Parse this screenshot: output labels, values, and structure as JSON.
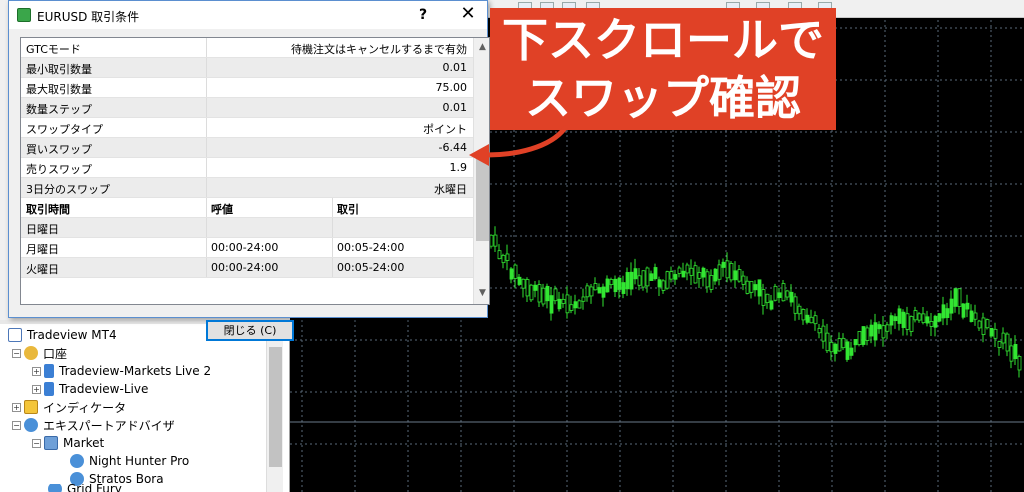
{
  "dialog": {
    "title": "EURUSD 取引条件",
    "help": "?",
    "close": "✕",
    "close_button": "閉じる (C)"
  },
  "specs": [
    {
      "label": "GTCモード",
      "value": "待機注文はキャンセルするまで有効"
    },
    {
      "label": "最小取引数量",
      "value": "0.01"
    },
    {
      "label": "最大取引数量",
      "value": "75.00"
    },
    {
      "label": "数量ステップ",
      "value": "0.01"
    },
    {
      "label": "スワップタイプ",
      "value": "ポイント"
    },
    {
      "label": "買いスワップ",
      "value": "-6.44"
    },
    {
      "label": "売りスワップ",
      "value": "1.9"
    },
    {
      "label": "3日分のスワップ",
      "value": "水曜日"
    }
  ],
  "sessions": {
    "headers": [
      "取引時間",
      "呼値",
      "取引"
    ],
    "rows": [
      [
        "日曜日",
        "",
        ""
      ],
      [
        "月曜日",
        "00:00-24:00",
        "00:05-24:00"
      ],
      [
        "火曜日",
        "00:00-24:00",
        "00:05-24:00"
      ]
    ]
  },
  "navigator": {
    "root": "Tradeview MT4",
    "items": [
      {
        "label": "口座"
      },
      {
        "label": "Tradeview-Markets Live 2"
      },
      {
        "label": "Tradeview-Live"
      },
      {
        "label": "インディケータ"
      },
      {
        "label": "エキスパートアドバイザ"
      },
      {
        "label": "Market"
      },
      {
        "label": "Night Hunter Pro"
      },
      {
        "label": "Stratos Bora"
      },
      {
        "label": "Grid Fury"
      }
    ]
  },
  "callout": {
    "line1": "下スクロールで",
    "line2": "スワップ確認",
    "color": "#e04126"
  },
  "colors": {
    "chart_bg": "#000000",
    "candle": "#32e632",
    "grid": "#5a6a7a"
  }
}
